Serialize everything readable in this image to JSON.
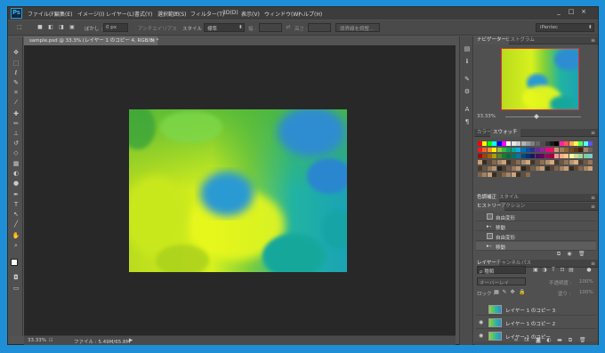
{
  "app": {
    "logo": "Ps"
  },
  "menu": [
    "ファイル(F)",
    "編集(E)",
    "イメージ(I)",
    "レイヤー(L)",
    "書式(Y)",
    "選択範囲(S)",
    "フィルター(T)",
    "3D(D)",
    "表示(V)",
    "ウィンドウ(W)",
    "ヘルプ(H)"
  ],
  "window_controls": {
    "minimize": "_",
    "maximize": "□",
    "close": "×"
  },
  "options": {
    "feather_label": "ぼかし :",
    "feather_value": "0 px",
    "antialias": "アンチエイリアス",
    "style_label": "スタイル :",
    "style_value": "標準",
    "width_label": "幅 :",
    "height_label": "高さ :",
    "refine_edge": "境界線を調整...",
    "workspace": "iPentec"
  },
  "document": {
    "tab_title": "sample.psd @ 33.3% (レイヤー 1 のコピー 4, RGB/8) *",
    "tab_close": "×"
  },
  "canvas_colors": {
    "base_left": "#c4e21c",
    "base_right": "#1da7b0",
    "accent_blue": "#2a8fd6",
    "accent_green": "#6cc83a"
  },
  "status": {
    "zoom": "33.33%",
    "file": "ファイル : 5.49M/65.8M",
    "arrow": "▶"
  },
  "navigator": {
    "tabs": [
      "ナビゲーター",
      "ヒストグラム"
    ],
    "zoom": "33.33%"
  },
  "swatches_panel": {
    "tabs": [
      "カラー",
      "スウォッチ"
    ]
  },
  "styles_panel": {
    "tabs": [
      "色調補正",
      "スタイル"
    ]
  },
  "history_panel": {
    "tabs": [
      "ヒストリー",
      "アクション"
    ],
    "items": [
      "自由変形",
      "移動",
      "自由変形",
      "移動"
    ]
  },
  "layers_panel": {
    "tabs": [
      "レイヤー",
      "チャンネル",
      "パス"
    ],
    "filter": "ρ 種類",
    "blend": "オーバーレイ",
    "opacity_label": "不透明度 :",
    "opacity_value": "100%",
    "lock_label": "ロック :",
    "fill_label": "塗り :",
    "fill_value": "100%",
    "layers": [
      "レイヤー 1 のコピー 3",
      "レイヤー 1 のコピー 2",
      "レイヤー 1 のコピー"
    ]
  }
}
